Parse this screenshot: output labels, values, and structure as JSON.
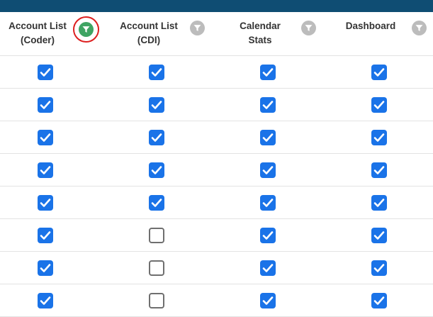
{
  "columns": [
    {
      "key": "account_list_coder",
      "label": "Account List\n(Coder)",
      "filter_icon": "filter-icon",
      "filter_active": true,
      "highlighted": true
    },
    {
      "key": "account_list_cdi",
      "label": "Account List\n(CDI)",
      "filter_icon": "filter-icon",
      "filter_active": false,
      "highlighted": false
    },
    {
      "key": "calendar_stats",
      "label": "Calendar\nStats",
      "filter_icon": "filter-icon",
      "filter_active": false,
      "highlighted": false
    },
    {
      "key": "dashboard",
      "label": "Dashboard",
      "filter_icon": "filter-icon",
      "filter_active": false,
      "highlighted": false
    }
  ],
  "rows": [
    [
      true,
      true,
      true,
      true
    ],
    [
      true,
      true,
      true,
      true
    ],
    [
      true,
      true,
      true,
      true
    ],
    [
      true,
      true,
      true,
      true
    ],
    [
      true,
      true,
      true,
      true
    ],
    [
      true,
      false,
      true,
      true
    ],
    [
      true,
      false,
      true,
      true
    ],
    [
      true,
      false,
      true,
      true
    ]
  ],
  "colors": {
    "top_bar": "#0f4d73",
    "checkbox_checked": "#1a73e8",
    "filter_active": "#3fa463",
    "filter_inactive": "#bcbcbc",
    "highlight_ring": "#dd1f1f"
  }
}
